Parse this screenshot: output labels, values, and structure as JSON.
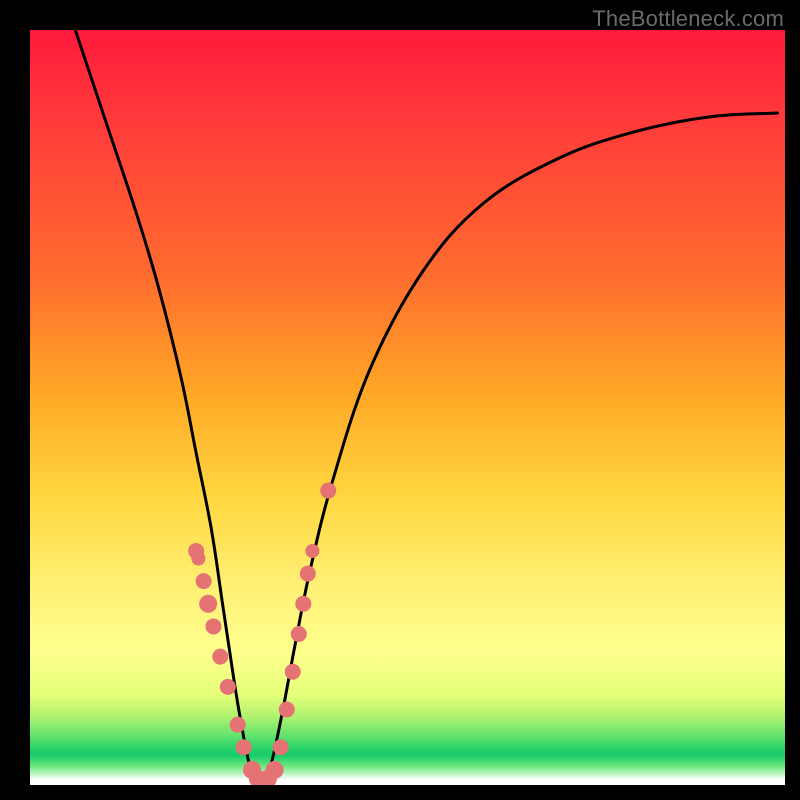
{
  "watermark": "TheBottleneck.com",
  "chart_data": {
    "type": "line",
    "title": "",
    "xlabel": "",
    "ylabel": "",
    "ylim": [
      0,
      100
    ],
    "xlim": [
      0,
      100
    ],
    "series": [
      {
        "name": "bottleneck-curve",
        "x": [
          6,
          10,
          14,
          17,
          20,
          22,
          24,
          25.5,
          27,
          28,
          29,
          30,
          31,
          32,
          33.5,
          35,
          37,
          40,
          45,
          52,
          60,
          70,
          80,
          90,
          99
        ],
        "y": [
          100,
          88,
          76,
          66,
          54,
          44,
          34,
          24,
          14,
          8,
          3,
          0.5,
          0.5,
          3,
          10,
          18,
          28,
          40,
          55,
          68,
          77,
          83,
          86.5,
          88.5,
          89
        ]
      }
    ],
    "markers": [
      {
        "x": 22.0,
        "y": 31,
        "r": 8
      },
      {
        "x": 22.3,
        "y": 30,
        "r": 7
      },
      {
        "x": 23.0,
        "y": 27,
        "r": 8
      },
      {
        "x": 23.6,
        "y": 24,
        "r": 9
      },
      {
        "x": 24.3,
        "y": 21,
        "r": 8
      },
      {
        "x": 25.2,
        "y": 17,
        "r": 8
      },
      {
        "x": 26.2,
        "y": 13,
        "r": 8
      },
      {
        "x": 27.5,
        "y": 8,
        "r": 8
      },
      {
        "x": 28.3,
        "y": 5,
        "r": 8
      },
      {
        "x": 29.4,
        "y": 2,
        "r": 9
      },
      {
        "x": 30.2,
        "y": 0.8,
        "r": 9
      },
      {
        "x": 31.5,
        "y": 0.8,
        "r": 9
      },
      {
        "x": 32.4,
        "y": 2,
        "r": 9
      },
      {
        "x": 33.2,
        "y": 5,
        "r": 8
      },
      {
        "x": 34.0,
        "y": 10,
        "r": 8
      },
      {
        "x": 34.8,
        "y": 15,
        "r": 8
      },
      {
        "x": 35.6,
        "y": 20,
        "r": 8
      },
      {
        "x": 36.2,
        "y": 24,
        "r": 8
      },
      {
        "x": 36.8,
        "y": 28,
        "r": 8
      },
      {
        "x": 37.4,
        "y": 31,
        "r": 7
      },
      {
        "x": 39.5,
        "y": 39,
        "r": 8
      }
    ],
    "marker_color": "#e57373"
  }
}
